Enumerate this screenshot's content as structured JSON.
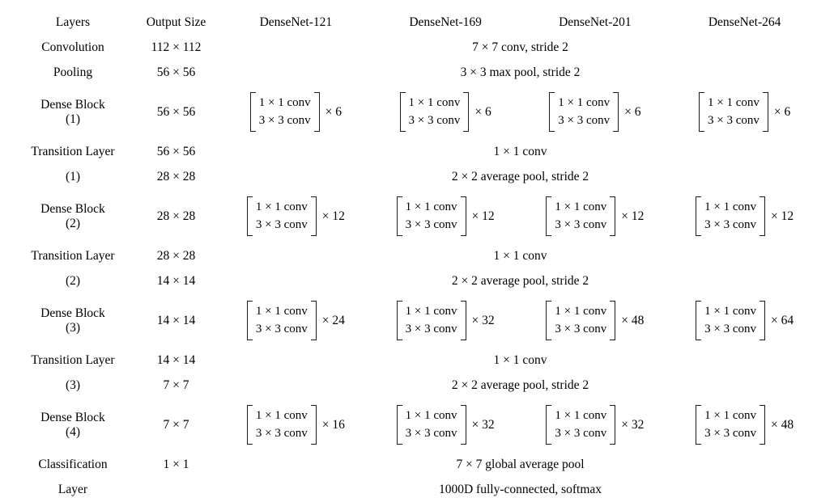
{
  "table": {
    "headers": {
      "layers": "Layers",
      "output_size": "Output Size",
      "networks": [
        "DenseNet-121",
        "DenseNet-169",
        "DenseNet-201",
        "DenseNet-264"
      ]
    },
    "rows": {
      "convolution": {
        "layer": "Convolution",
        "output_size": "112 × 112",
        "spec": "7 × 7 conv, stride 2"
      },
      "pooling": {
        "layer": "Pooling",
        "output_size": "56 × 56",
        "spec": "3 × 3 max pool, stride 2"
      },
      "dense_block_1": {
        "layer_line1": "Dense Block",
        "layer_line2": "(1)",
        "output_size": "56 × 56",
        "conv_line1": "1 × 1 conv",
        "conv_line2": "3 × 3 conv",
        "multipliers": [
          "× 6",
          "× 6",
          "× 6",
          "× 6"
        ]
      },
      "transition_layer_1": {
        "layer_line1": "Transition Layer",
        "layer_line2": "(1)",
        "output_size_a": "56 × 56",
        "output_size_b": "28 × 28",
        "spec_a": "1 × 1 conv",
        "spec_b": "2 × 2 average pool, stride 2"
      },
      "dense_block_2": {
        "layer_line1": "Dense Block",
        "layer_line2": "(2)",
        "output_size": "28 × 28",
        "conv_line1": "1 × 1 conv",
        "conv_line2": "3 × 3 conv",
        "multipliers": [
          "× 12",
          "× 12",
          "× 12",
          "× 12"
        ]
      },
      "transition_layer_2": {
        "layer_line1": "Transition Layer",
        "layer_line2": "(2)",
        "output_size_a": "28 × 28",
        "output_size_b": "14 × 14",
        "spec_a": "1 × 1 conv",
        "spec_b": "2 × 2 average pool, stride 2"
      },
      "dense_block_3": {
        "layer_line1": "Dense Block",
        "layer_line2": "(3)",
        "output_size": "14 × 14",
        "conv_line1": "1 × 1 conv",
        "conv_line2": "3 × 3 conv",
        "multipliers": [
          "× 24",
          "× 32",
          "× 48",
          "× 64"
        ]
      },
      "transition_layer_3": {
        "layer_line1": "Transition Layer",
        "layer_line2": "(3)",
        "output_size_a": "14 × 14",
        "output_size_b": "7 × 7",
        "spec_a": "1 × 1 conv",
        "spec_b": "2 × 2 average pool, stride 2"
      },
      "dense_block_4": {
        "layer_line1": "Dense Block",
        "layer_line2": "(4)",
        "output_size": "7 × 7",
        "conv_line1": "1 × 1 conv",
        "conv_line2": "3 × 3 conv",
        "multipliers": [
          "× 16",
          "× 32",
          "× 32",
          "× 48"
        ]
      },
      "classification_layer": {
        "layer_line1": "Classification",
        "layer_line2": "Layer",
        "output_size_a": "1 × 1",
        "output_size_b": "",
        "spec_a": "7 × 7 global average pool",
        "spec_b": "1000D fully-connected, softmax"
      }
    }
  }
}
